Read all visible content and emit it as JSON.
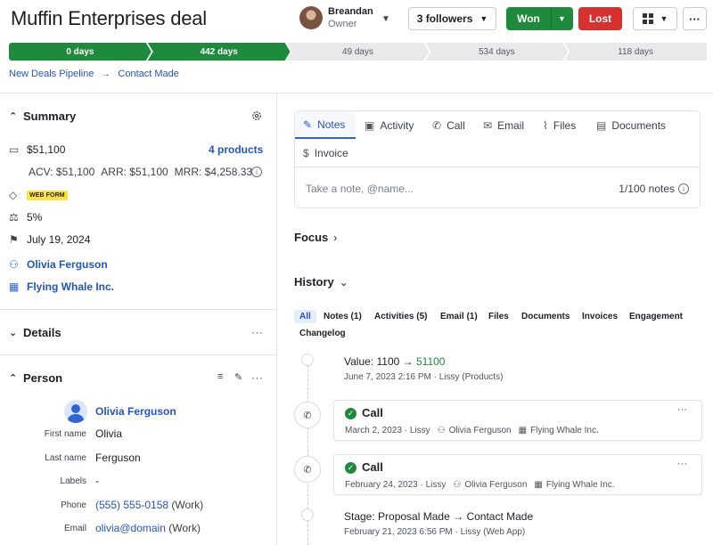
{
  "deal": {
    "title": "Muffin Enterprises deal"
  },
  "owner": {
    "name": "Breandan",
    "role": "Owner"
  },
  "header": {
    "followers_label": "3 followers",
    "won_label": "Won",
    "lost_label": "Lost",
    "more_label": "···"
  },
  "pipeline": {
    "stages": [
      {
        "label": "0 days",
        "status": "done"
      },
      {
        "label": "442 days",
        "status": "done"
      },
      {
        "label": "49 days",
        "status": "todo"
      },
      {
        "label": "534 days",
        "status": "todo"
      },
      {
        "label": "118 days",
        "status": "todo"
      }
    ]
  },
  "breadcrumb": {
    "pipeline": "New Deals Pipeline",
    "separator": "→",
    "stage": "Contact Made"
  },
  "summary": {
    "heading": "Summary",
    "value": "$51,100",
    "products_link": "4 products",
    "acv": "ACV: $51,100",
    "arr": "ARR: $51,100",
    "mrr": "MRR: $4,258.33",
    "source_badge": "WEB FORM",
    "probability": "5%",
    "close_date": "July 19, 2024",
    "person": "Olivia Ferguson",
    "organization": "Flying Whale Inc."
  },
  "details": {
    "heading": "Details"
  },
  "person": {
    "heading": "Person",
    "name": "Olivia Ferguson",
    "fields": [
      {
        "label": "First name",
        "value": "Olivia",
        "suffix": ""
      },
      {
        "label": "Last name",
        "value": "Ferguson",
        "suffix": ""
      },
      {
        "label": "Labels",
        "value": "-",
        "suffix": ""
      },
      {
        "label": "Phone",
        "value": "(555) 555-0158",
        "suffix": "(Work)"
      },
      {
        "label": "Email",
        "value": "olivia@domain",
        "suffix": "(Work)"
      }
    ]
  },
  "composer": {
    "tabs": [
      "Notes",
      "Activity",
      "Call",
      "Email",
      "Files",
      "Documents",
      "Invoice"
    ],
    "placeholder": "Take a note, @name...",
    "count": "1/100 notes"
  },
  "focus": {
    "heading": "Focus"
  },
  "history": {
    "heading": "History",
    "filters": [
      "All",
      "Notes (1)",
      "Activities (5)",
      "Email (1)",
      "Files",
      "Documents",
      "Invoices",
      "Engagement",
      "Changelog"
    ],
    "items": [
      {
        "kind": "change",
        "label": "Value",
        "from": "1100",
        "arrow": "→",
        "to": "51100",
        "meta": "June 7, 2023 2:16 PM · Lissy (Products)"
      },
      {
        "kind": "call",
        "title": "Call",
        "date": "March 2, 2023 · Lissy",
        "person": "Olivia Ferguson",
        "org": "Flying Whale Inc."
      },
      {
        "kind": "call",
        "title": "Call",
        "date": "February 24, 2023 · Lissy",
        "person": "Olivia Ferguson",
        "org": "Flying Whale Inc."
      },
      {
        "kind": "change",
        "label": "Stage",
        "from": "Proposal Made",
        "arrow": "→",
        "to": "Contact Made",
        "meta": "February 21, 2023 6:56 PM · Lissy (Web App)"
      }
    ]
  },
  "colors": {
    "accent_blue": "#2255c4",
    "won_green": "#1e8a3c",
    "lost_red": "#d6312f",
    "badge_yellow": "#ffe23a"
  }
}
